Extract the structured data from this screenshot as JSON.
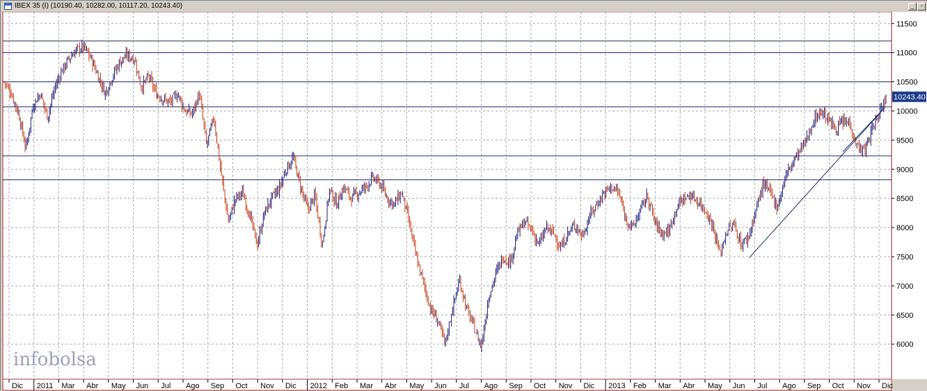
{
  "window": {
    "title": "IBEX 35 (I) (10190.40, 10282.00, 10117.20, 10243.40)",
    "minimize_glyph": "_",
    "restore_glyph": "▫",
    "close_glyph": "✕"
  },
  "branding": {
    "logo_text": "infobolsa"
  },
  "colors": {
    "up": "#1a1a7a",
    "down": "#c83a10",
    "grid": "#a8a8a8",
    "hline": "#1a2a6e",
    "last_price_bg": "#1a3a8a"
  },
  "chart_data": {
    "type": "line",
    "style": "ohlc-bars",
    "title": "IBEX 35 (I) (10190.40, 10282.00, 10117.20, 10243.40)",
    "ohlc_last": {
      "open": 10190.4,
      "high": 10282.0,
      "low": 10117.2,
      "close": 10243.4
    },
    "last_price_label": "10243.40",
    "ylim": [
      5400,
      11700
    ],
    "y_ticks": [
      11500,
      11000,
      10500,
      10000,
      9500,
      9000,
      8500,
      8000,
      7500,
      7000,
      6500,
      6000
    ],
    "x_month_labels": [
      "Dic",
      "2011",
      "Mar",
      "Abr",
      "May",
      "Jun",
      "Jul",
      "Ago",
      "Sep",
      "Oct",
      "Nov",
      "Dic",
      "2012",
      "Feb",
      "Mar",
      "Abr",
      "May",
      "Jun",
      "Jul",
      "Ago",
      "Sep",
      "Oct",
      "Nov",
      "Dic",
      "2013",
      "Feb",
      "Mar",
      "Abr",
      "May",
      "Jun",
      "Jul",
      "Ago",
      "Sep",
      "Oct",
      "Nov",
      "Dic"
    ],
    "horizontal_lines": [
      11200,
      11000,
      10500,
      10070,
      9230,
      8820
    ],
    "trendline": {
      "from": [
        7480,
        "Jul 2013"
      ],
      "to": [
        10050,
        "Dic 2013"
      ]
    },
    "series": [
      {
        "values": [
          10500,
          10300,
          9950,
          9350,
          10100,
          10300,
          9900,
          10400,
          10700,
          10900,
          11050,
          11100,
          10900,
          10600,
          10300,
          10600,
          10850,
          10950,
          10900,
          10400,
          10600,
          10300,
          10200,
          10150,
          10300,
          10000,
          9950,
          10300,
          9400,
          9900,
          8950,
          8100,
          8500,
          8600,
          8200,
          7700,
          8250,
          8500,
          8650,
          9000,
          9200,
          8700,
          8300,
          8550,
          7700,
          8650,
          8400,
          8700,
          8500,
          8600,
          8700,
          8850,
          8750,
          8500,
          8400,
          8600,
          8100,
          7500,
          7050,
          6600,
          6400,
          6000,
          6600,
          7100,
          6600,
          6300,
          5950,
          6800,
          7200,
          7500,
          7400,
          7900,
          8100,
          7950,
          7700,
          8000,
          7900,
          7650,
          7900,
          8050,
          7850,
          8200,
          8400,
          8600,
          8700,
          8600,
          8150,
          8000,
          8300,
          8550,
          8100,
          7900,
          7950,
          8350,
          8500,
          8550,
          8450,
          8300,
          8050,
          7550,
          7950,
          8050,
          7700,
          7850,
          8300,
          8750,
          8600,
          8350,
          8850,
          9100,
          9300,
          9500,
          9850,
          10000,
          9850,
          9700,
          9800,
          9800,
          9400,
          9300,
          9650,
          9950,
          10243.4
        ]
      }
    ]
  }
}
